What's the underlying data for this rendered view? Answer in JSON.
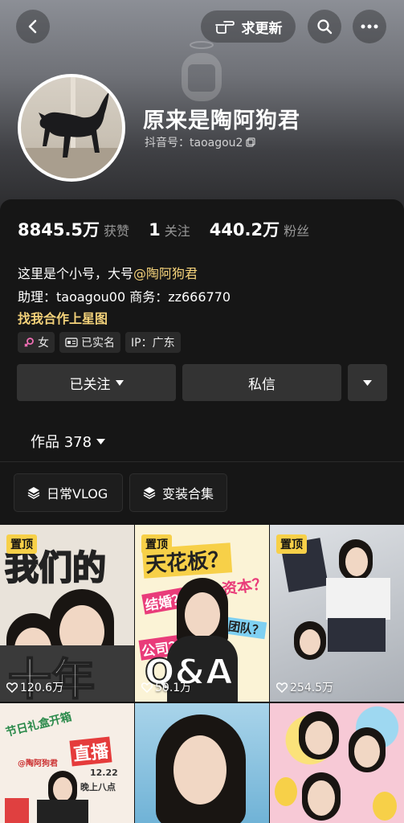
{
  "header": {
    "update_label": "求更新",
    "name": "原来是陶阿狗君",
    "douyin_id": "抖音号：taoagou2"
  },
  "stats": [
    {
      "value": "8845.5万",
      "label": "获赞"
    },
    {
      "value": "1",
      "label": "关注"
    },
    {
      "value": "440.2万",
      "label": "粉丝"
    }
  ],
  "bio": {
    "line1_text": "这里是个小号，大号",
    "line1_mention": "@陶阿狗君",
    "line2": "助理：taoagou00  商务：zz666770",
    "link": "找我合作上星图"
  },
  "tags": [
    {
      "icon": "female-icon",
      "label": "女"
    },
    {
      "icon": "id-card-icon",
      "label": "已实名"
    },
    {
      "icon": "",
      "label": "IP：广东"
    }
  ],
  "actions": {
    "followed": "已关注",
    "message": "私信"
  },
  "works_tab": {
    "label": "作品 378"
  },
  "collections": [
    {
      "icon": "stack-icon",
      "label": "日常VLOG"
    },
    {
      "icon": "stack-icon",
      "label": "变装合集"
    }
  ],
  "videos": [
    {
      "pinned": "置顶",
      "likes": "120.6万",
      "text": [
        "我们的",
        "十年"
      ]
    },
    {
      "pinned": "置顶",
      "likes": "50.1万",
      "text": [
        "天花板？",
        "资本？",
        "结婚？",
        "公司？",
        "团队？",
        "Q&A"
      ]
    },
    {
      "pinned": "置顶",
      "likes": "254.5万",
      "text": []
    },
    {
      "pinned": "",
      "likes": "",
      "text": [
        "节日礼盒开箱",
        "直播",
        "@陶阿狗君",
        "12.22",
        "晚上八点"
      ]
    },
    {
      "pinned": "",
      "likes": "",
      "text": []
    },
    {
      "pinned": "",
      "likes": "",
      "text": []
    }
  ],
  "colors": {
    "accent": "#f4d27a",
    "pin": "#f7d048",
    "bg": "#161616"
  }
}
